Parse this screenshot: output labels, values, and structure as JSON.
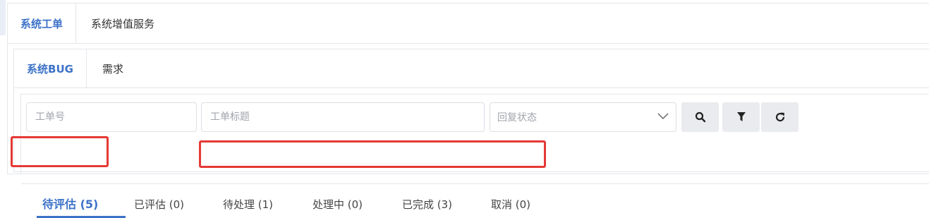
{
  "outer_tabs": [
    {
      "label": "系统工单"
    },
    {
      "label": "系统增值服务"
    }
  ],
  "inner_tabs": [
    {
      "label": "系统BUG"
    },
    {
      "label": "需求"
    }
  ],
  "filters": {
    "ticket_no_placeholder": "工单号",
    "ticket_title_placeholder": "工单标题",
    "reply_status_placeholder": "回复状态"
  },
  "status_tabs": [
    {
      "label": "待评估 (5)"
    },
    {
      "label": "已评估 (0)"
    },
    {
      "label": "待处理 (1)"
    },
    {
      "label": "处理中 (0)"
    },
    {
      "label": "已完成 (3)"
    },
    {
      "label": "取消 (0)"
    }
  ],
  "colors": {
    "accent": "#3d73c8",
    "highlight": "#e53935"
  },
  "icons": {
    "search_button": "search-icon",
    "filter_button": "filter-icon",
    "refresh_button": "refresh-icon",
    "select_arrow": "chevron-down-icon"
  }
}
